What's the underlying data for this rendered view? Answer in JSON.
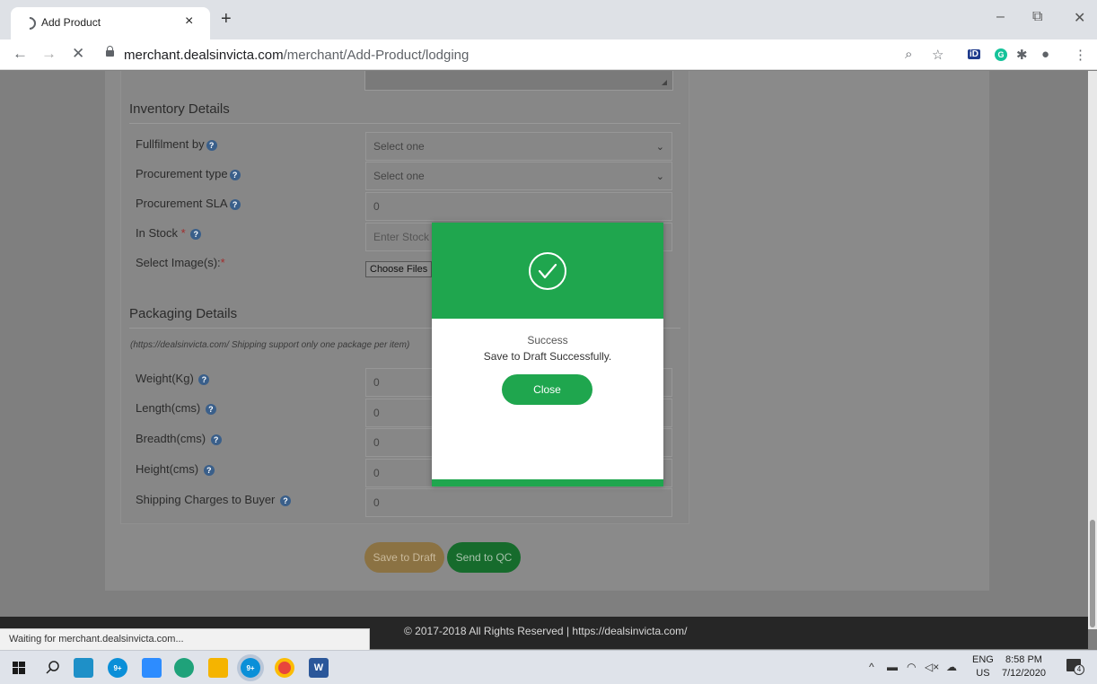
{
  "browser": {
    "tab_title": "Add Product",
    "new_tab": "+",
    "tab_close": "×",
    "url_host": "merchant.dealsinvicta.com",
    "url_path": "/merchant/Add-Product/lodging",
    "minimize": "–",
    "restore": "⧉",
    "close": "✕",
    "back": "←",
    "forward": "→",
    "stop": "✕",
    "search_glyph": "⌕",
    "star_glyph": "☆",
    "ext_id_label": "iD",
    "ext_g_label": "G",
    "puzzle_glyph": "✱",
    "profile_glyph": "●",
    "menu_glyph": "⋮"
  },
  "inventory": {
    "title": "Inventory Details",
    "fulfilment_label": "Fullfilment by",
    "fulfilment_value": "Select one",
    "procurement_type_label": "Procurement type",
    "procurement_type_value": "Select one",
    "procurement_sla_label": "Procurement SLA",
    "procurement_sla_value": "0",
    "in_stock_label": "In Stock",
    "in_stock_placeholder": "Enter Stock Q",
    "images_label": "Select Image(s):",
    "choose_files": "Choose Files",
    "required_mark": "*",
    "help_glyph": "?",
    "chevron": "⌄"
  },
  "packaging": {
    "title": "Packaging Details",
    "note": "(https://dealsinvicta.com/ Shipping support only one package per item)",
    "weight_label": "Weight(Kg)",
    "weight_value": "0",
    "length_label": "Length(cms)",
    "length_value": "0",
    "breadth_label": "Breadth(cms)",
    "breadth_value": "0",
    "height_label": "Height(cms)",
    "height_value": "0",
    "shipping_label": "Shipping Charges to Buyer",
    "shipping_value": "0"
  },
  "actions": {
    "save_draft": "Save to Draft",
    "send_qc": "Send to QC"
  },
  "footer": {
    "copyright": "© 2017-2018 All Rights Reserved | https://dealsinvicta.com/"
  },
  "status_bar": {
    "text": "Waiting for merchant.dealsinvicta.com..."
  },
  "modal": {
    "title": "Success",
    "message": "Save to Draft Successfully.",
    "close_label": "Close"
  },
  "taskbar": {
    "skype_badge": "9+",
    "word_label": "W",
    "lang_top": "ENG",
    "lang_bottom": "US",
    "time": "8:58 PM",
    "date": "7/12/2020",
    "notification_count": "4",
    "tray_chevron": "^"
  },
  "colors": {
    "success_green": "#1fa64e",
    "save_draft_gold": "#8b7243",
    "send_qc_green": "#166b2c",
    "footer_dark": "#262626"
  }
}
